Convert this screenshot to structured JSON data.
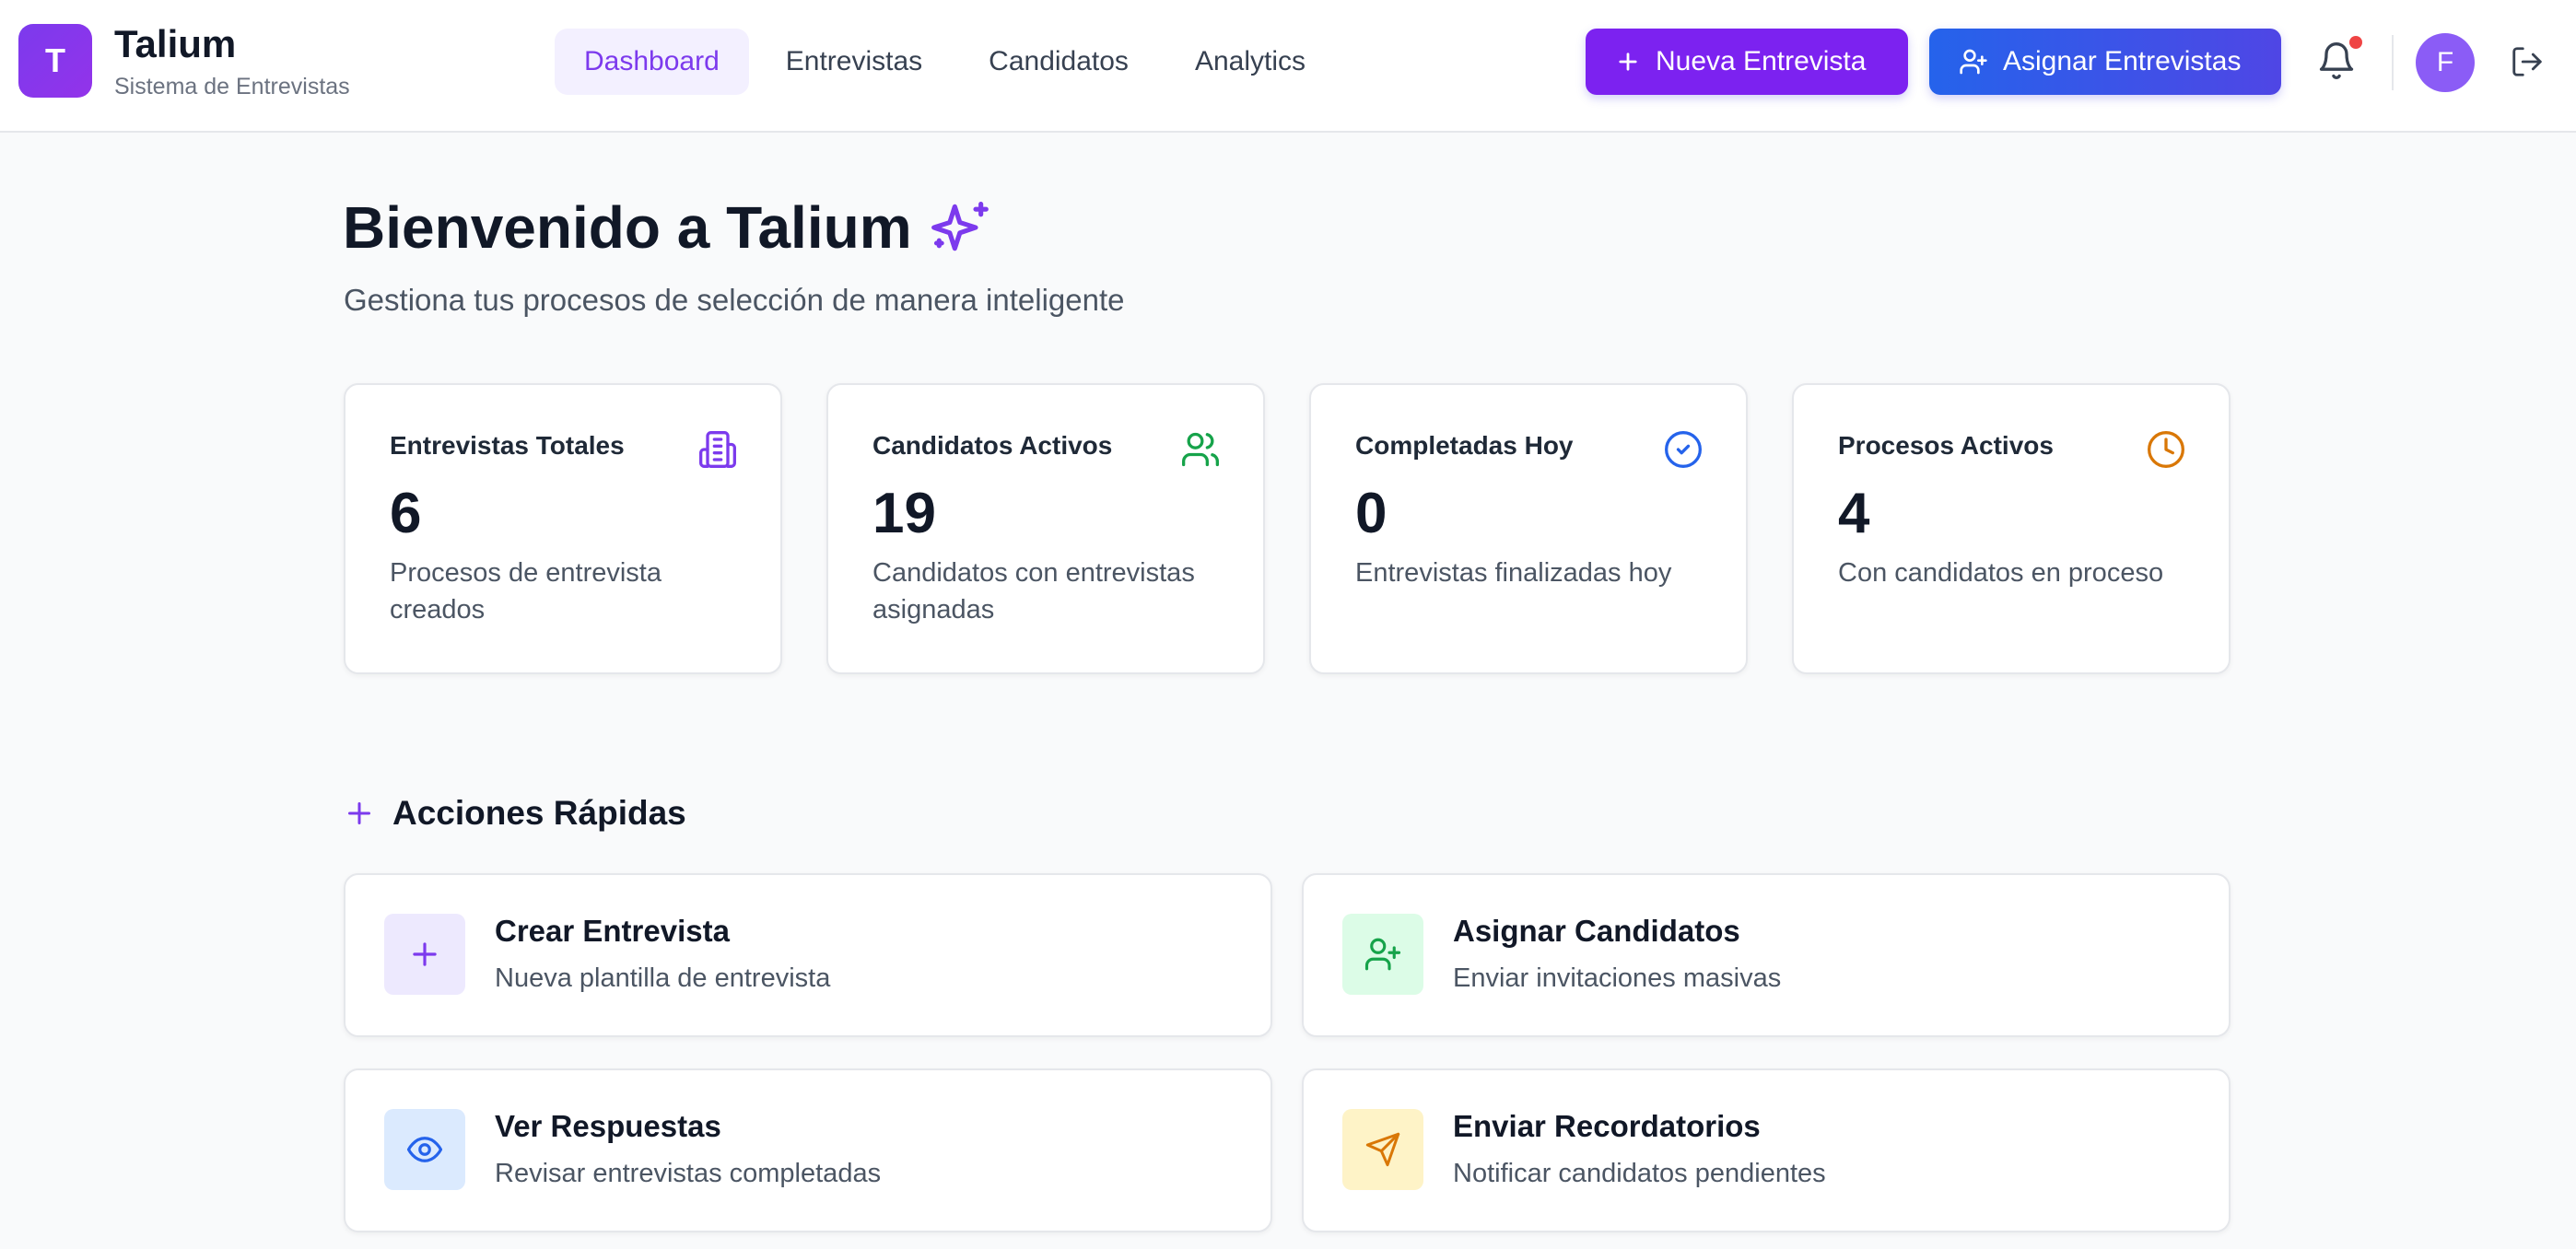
{
  "brand": {
    "logo_letter": "T",
    "name": "Talium",
    "subtitle": "Sistema de Entrevistas"
  },
  "nav": [
    {
      "label": "Dashboard",
      "active": true
    },
    {
      "label": "Entrevistas",
      "active": false
    },
    {
      "label": "Candidatos",
      "active": false
    },
    {
      "label": "Analytics",
      "active": false
    }
  ],
  "header_actions": {
    "new_interview_label": "Nueva Entrevista",
    "assign_interviews_label": "Asignar Entrevistas",
    "notifications_unread": true,
    "avatar_initial": "F"
  },
  "welcome": {
    "title": "Bienvenido a Talium",
    "subtitle": "Gestiona tus procesos de selección de manera inteligente"
  },
  "stats": [
    {
      "title": "Entrevistas Totales",
      "value": "6",
      "description": "Procesos de entrevista creados",
      "icon": "building-icon",
      "color": "#7c3aed"
    },
    {
      "title": "Candidatos Activos",
      "value": "19",
      "description": "Candidatos con entrevistas asignadas",
      "icon": "users-icon",
      "color": "#16a34a"
    },
    {
      "title": "Completadas Hoy",
      "value": "0",
      "description": "Entrevistas finalizadas hoy",
      "icon": "check-circle-icon",
      "color": "#2563eb"
    },
    {
      "title": "Procesos Activos",
      "value": "4",
      "description": "Con candidatos en proceso",
      "icon": "clock-icon",
      "color": "#d97706"
    }
  ],
  "quick_actions": {
    "title": "Acciones Rápidas",
    "items": [
      {
        "title": "Crear Entrevista",
        "description": "Nueva plantilla de entrevista",
        "icon": "plus-icon",
        "color": "#7c3aed",
        "bg": "#ede9fe"
      },
      {
        "title": "Asignar Candidatos",
        "description": "Enviar invitaciones masivas",
        "icon": "user-plus-icon",
        "color": "#16a34a",
        "bg": "#dcfce7"
      },
      {
        "title": "Ver Respuestas",
        "description": "Revisar entrevistas completadas",
        "icon": "eye-icon",
        "color": "#2563eb",
        "bg": "#dbeafe"
      },
      {
        "title": "Enviar Recordatorios",
        "description": "Notificar candidatos pendientes",
        "icon": "send-icon",
        "color": "#d97706",
        "bg": "#fef3c7"
      }
    ]
  }
}
